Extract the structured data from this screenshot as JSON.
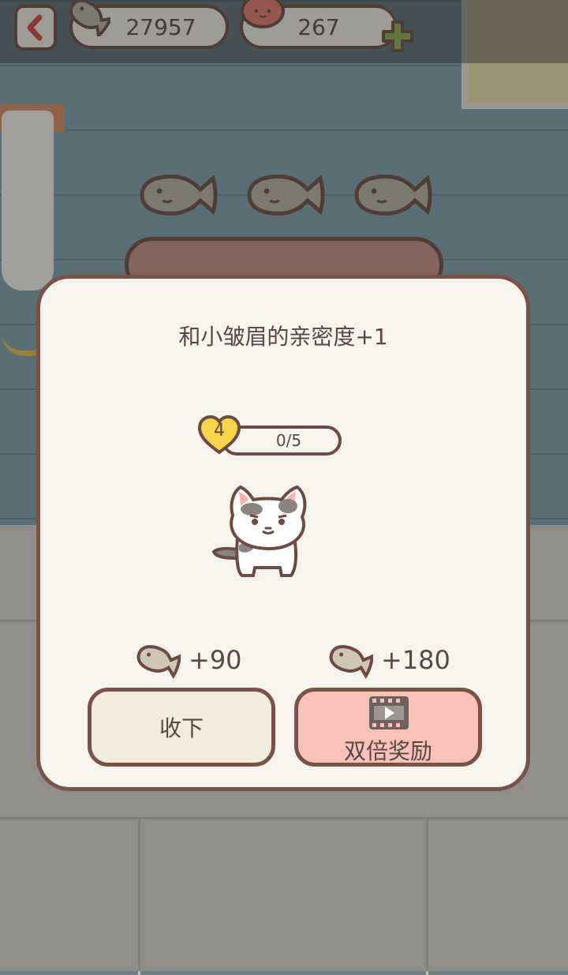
{
  "hud": {
    "fish_count": "27957",
    "gem_count": "267"
  },
  "dialog": {
    "title": "和小皱眉的亲密度+1",
    "intimacy_level": "4",
    "progress_text": "0/5",
    "progress_fraction": 0.0,
    "reward_normal": "+90",
    "reward_double": "+180",
    "collect_label": "收下",
    "double_label": "双倍奖励"
  },
  "icons": {
    "back": "chevron-left-icon",
    "fish": "fish-icon",
    "gem": "cat-face-coin-icon",
    "add": "plus-icon",
    "heart": "heart-icon",
    "video": "video-play-icon"
  },
  "colors": {
    "outline": "#6d4a42",
    "dialog_bg": "#f7f4ee",
    "collect_bg": "#f3ebdc",
    "double_bg": "#f7c3b8",
    "heart": "#f4d749",
    "plus": "#8bb04c"
  }
}
